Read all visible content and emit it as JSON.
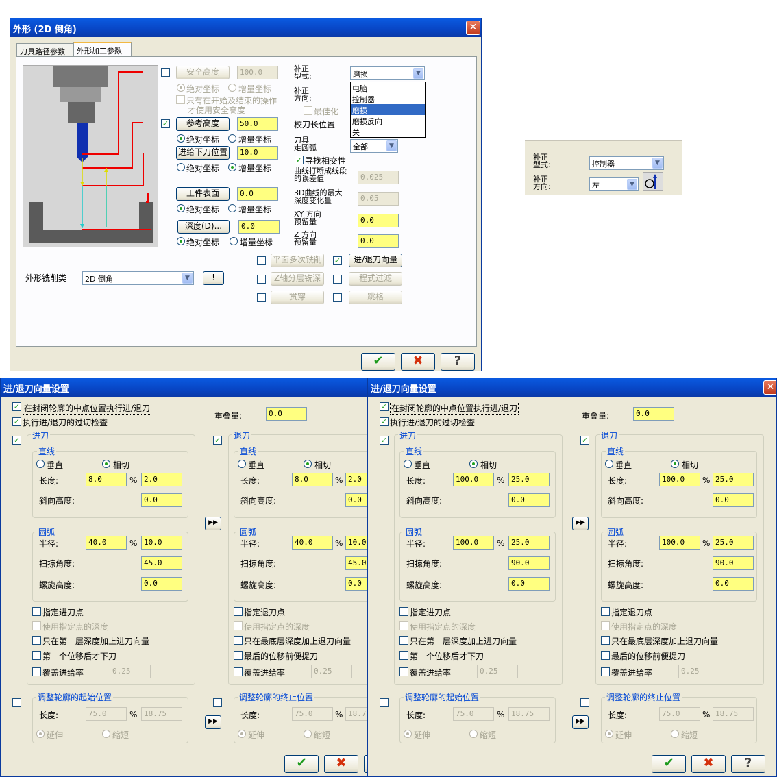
{
  "d1": {
    "title": "外形 (2D 倒角)",
    "close": "✕",
    "tabs": [
      "刀具路径参数",
      "外形加工参数"
    ],
    "safe_height": {
      "label": "安全高度",
      "value": "100.0"
    },
    "abs": "绝对坐标",
    "inc": "增量坐标",
    "only_start_end": "只有在开始及结束的操作",
    "use_safe": "才使用安全高度",
    "ref_height": {
      "label": "参考高度",
      "value": "50.0"
    },
    "feed_plane": {
      "label": "进给下刀位置",
      "value": "10.0"
    },
    "top_stock": {
      "label": "工件表面",
      "value": "0.0"
    },
    "depth": {
      "label": "深度(D)...",
      "value": "0.0"
    },
    "comp_type_label": "补正\n型式:",
    "comp_type_value": "磨损",
    "comp_dir_label": "补正\n方向:",
    "optimize": "最佳化",
    "tip_comp": "校刀长位置",
    "tool_roll_label": "刀具\n走圆弧",
    "tool_roll_value": "全部",
    "dropdown_options": [
      "电脑",
      "控制器",
      "磨损",
      "磨损反向",
      "关"
    ],
    "dropdown_selected": "磨损",
    "find_intersect": "寻找相交性",
    "linearize_label": "曲线打断成线段\n的误差值",
    "linearize_value": "0.025",
    "max_depth_label": "3D曲线的最大\n深度变化量",
    "max_depth_value": "0.05",
    "xy_stock_label": "XY 方向\n预留量",
    "xy_stock_value": "0.0",
    "z_stock_label": "Z 方向\n预留量",
    "z_stock_value": "0.0",
    "multi_pass": "平面多次铣削",
    "depth_cuts": "Z轴分层铣深",
    "break_through": "贯穿",
    "leadinout": "进/退刀向量",
    "filter": "程式过滤",
    "tab": "跳格",
    "contour_type_label": "外形铣削类",
    "contour_type_value": "2D 倒角",
    "ok": "✔",
    "cancel": "✖",
    "help": "?"
  },
  "mini": {
    "comp_type_label": "补正\n型式:",
    "comp_type_value": "控制器",
    "comp_dir_label": "补正\n方向:",
    "comp_dir_value": "左"
  },
  "dlg_title": "进/退刀向量设置",
  "dlg_common": {
    "midpoint": "在封闭轮廓的中点位置执行进/退刀",
    "gouge": "执行进/退刀的过切检查",
    "overlap_label": "重叠量:",
    "lead_in": "进刀",
    "lead_out": "退刀",
    "line": "直线",
    "perp": "垂直",
    "tangent": "相切",
    "length": "长度:",
    "pct": "%",
    "ramp": "斜向高度:",
    "arc": "圆弧",
    "radius": "半径:",
    "sweep": "扫掠角度:",
    "helix": "螺旋高度:",
    "entry_point": "指定进刀点",
    "exit_point": "指定退刀点",
    "use_depth": "使用指定点的深度",
    "first_depth": "只在第一层深度加上进刀向量",
    "last_depth": "只在最底层深度加上退刀向量",
    "after_first": "第一个位移后才下刀",
    "before_last": "最后的位移前便提刀",
    "override_feed": "覆盖进给率",
    "override_value": "0.25",
    "adj_start": "调整轮廓的起始位置",
    "adj_end": "调整轮廓的终止位置",
    "extend": "延伸",
    "shorten": "缩短",
    "adj_len": "75.0",
    "adj_pct": "18.75",
    "copy": "▶▶"
  },
  "dlg_a": {
    "overlap": "0.0",
    "len": "8.0",
    "len_pct": "2.0",
    "ramp": "0.0",
    "rad": "40.0",
    "rad_pct": "10.0",
    "sweep": "45.0",
    "helix": "0.0"
  },
  "dlg_b": {
    "overlap": "0.0",
    "len": "100.0",
    "len_pct": "25.0",
    "ramp": "0.0",
    "rad": "100.0",
    "rad_pct": "25.0",
    "sweep": "90.0",
    "helix": "0.0"
  },
  "colors": {
    "title_blue": "#0845c4",
    "field_yellow": "#ffff80",
    "dialog_bg": "#ece9d8"
  }
}
